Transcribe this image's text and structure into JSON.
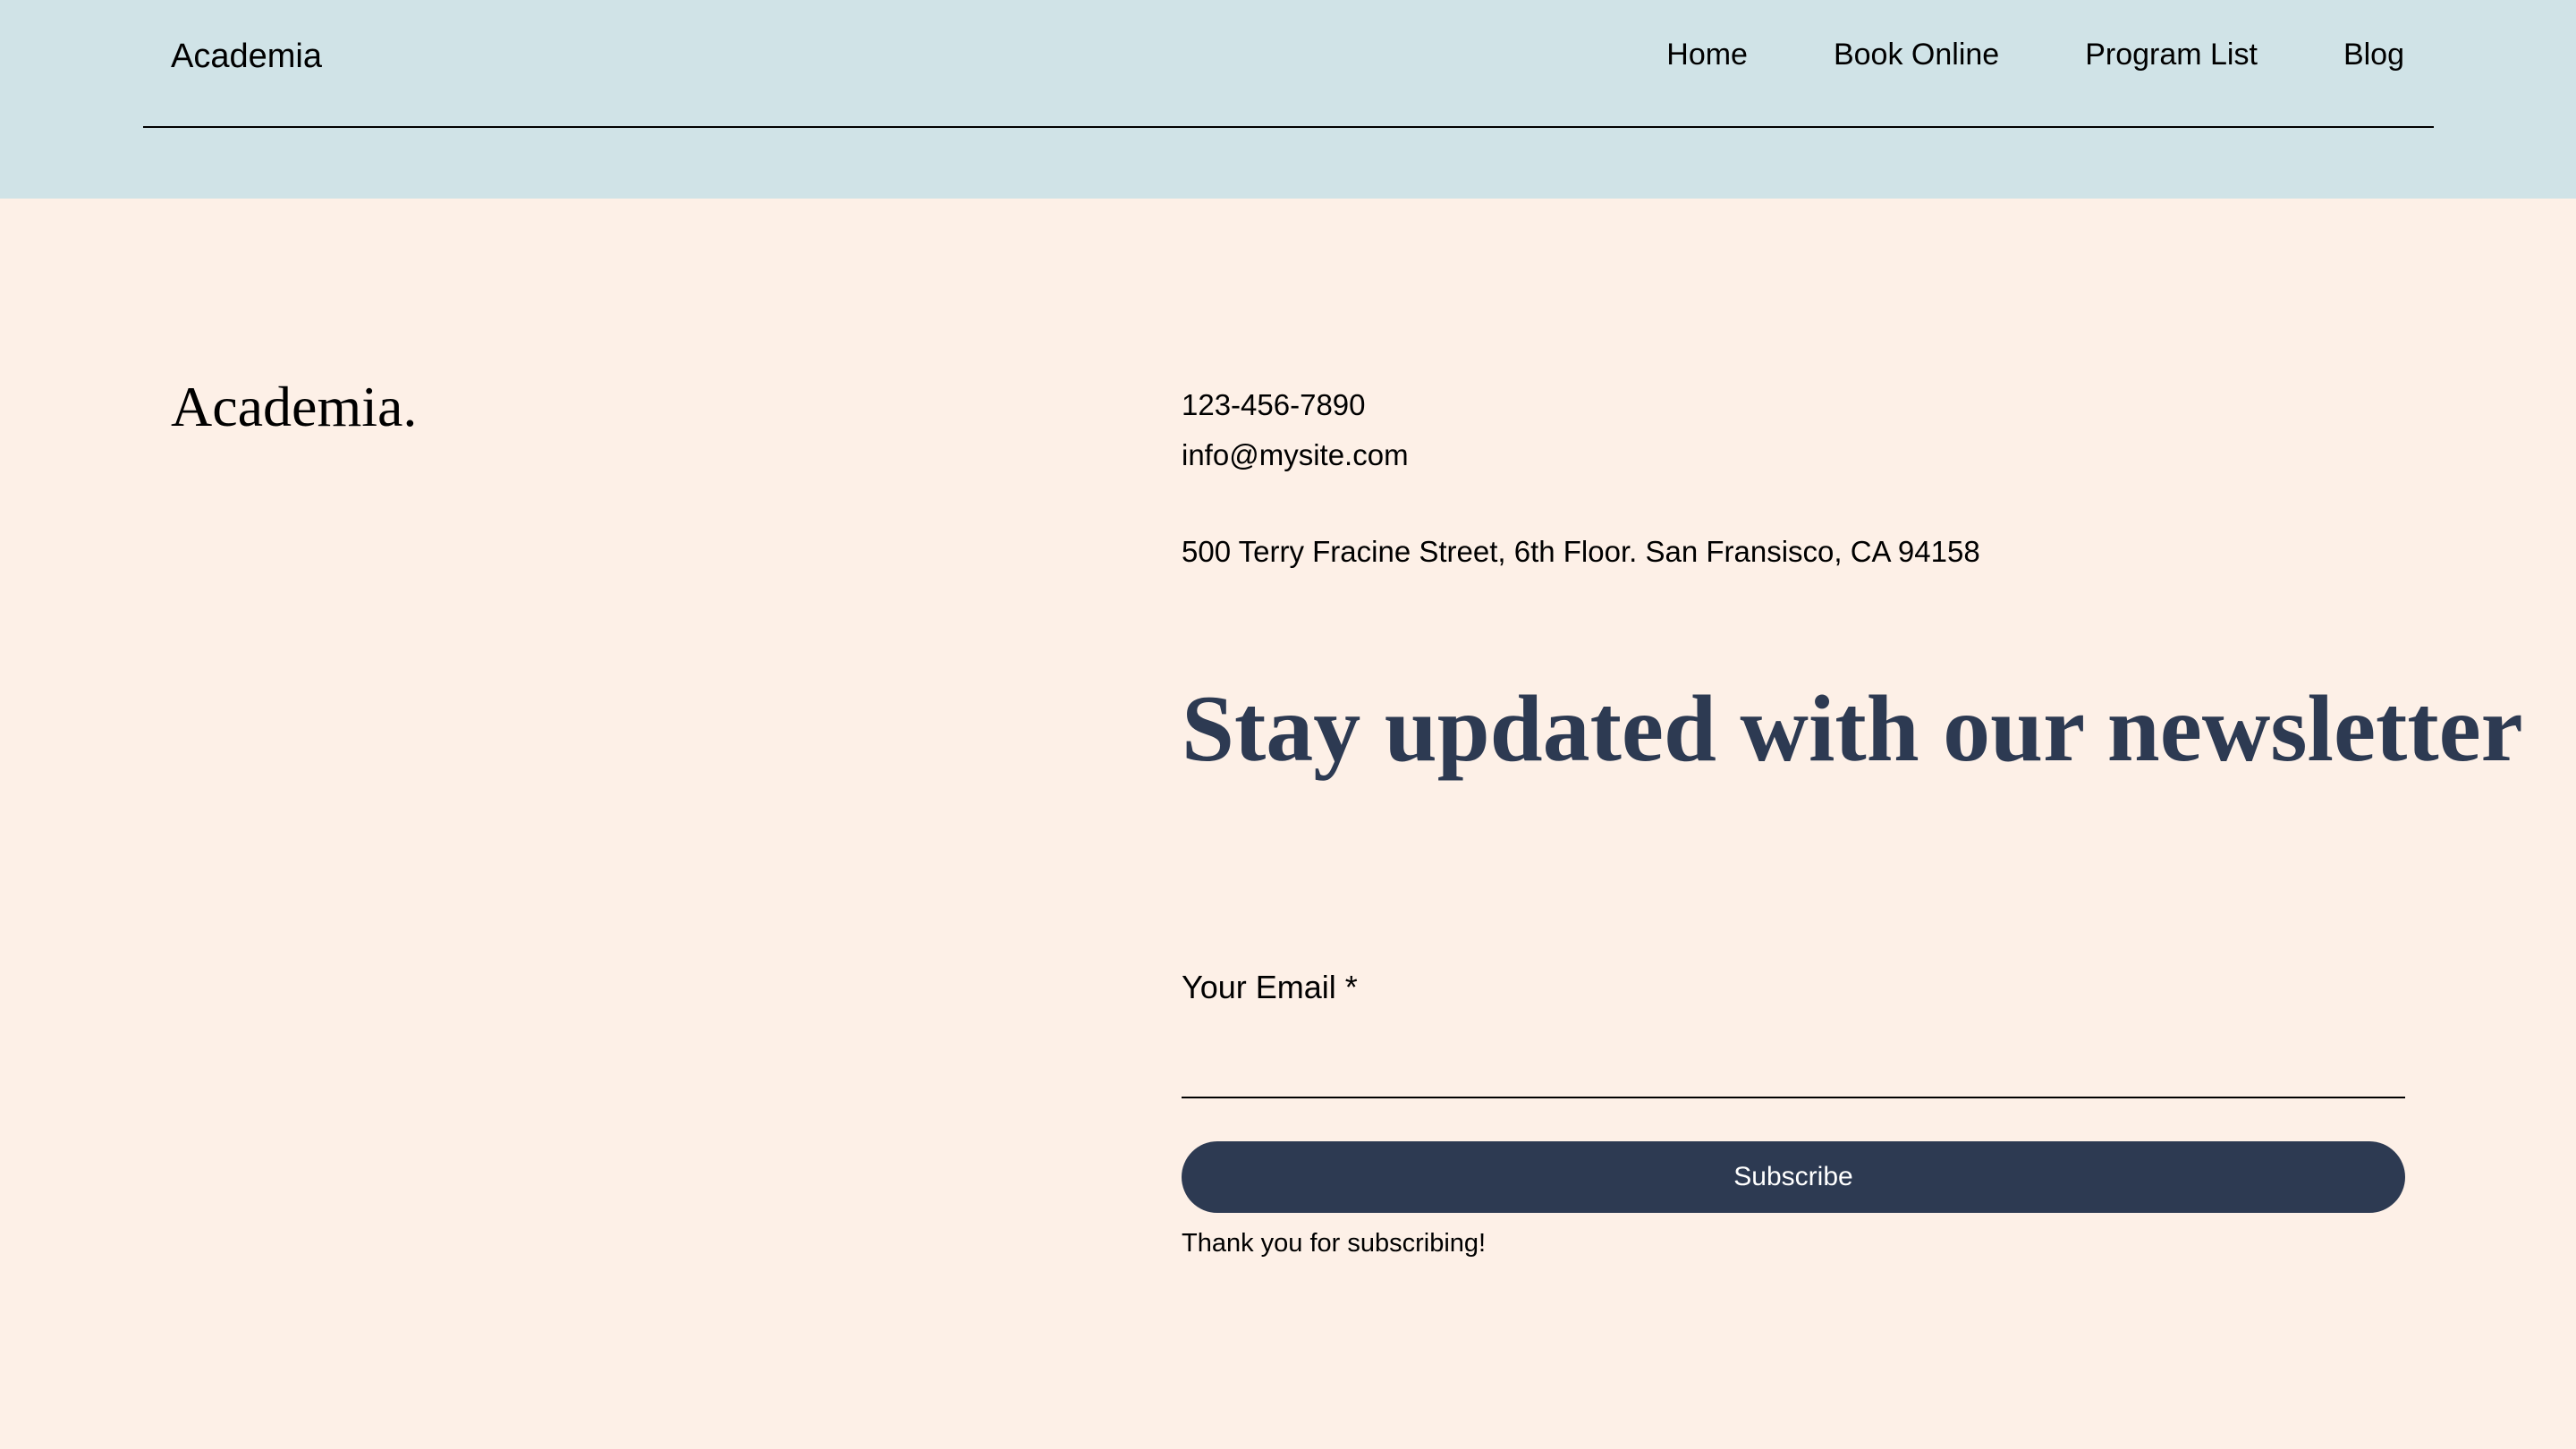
{
  "header": {
    "brand": "Academia",
    "nav": {
      "home": "Home",
      "book_online": "Book Online",
      "program_list": "Program List",
      "blog": "Blog"
    }
  },
  "footer": {
    "logo": "Academia.",
    "phone": "123-456-7890",
    "email": "info@mysite.com",
    "address": "500 Terry Fracine Street, 6th Floor. San Fransisco, CA 94158"
  },
  "newsletter": {
    "headline": "Stay updated with our newsletter",
    "email_label": "Your Email *",
    "email_value": "",
    "subscribe_label": "Subscribe",
    "thanks_message": "Thank you for subscribing!"
  },
  "colors": {
    "header_bg": "#d0e3e7",
    "page_bg": "#fdf0e7",
    "accent": "#2d3a52"
  }
}
